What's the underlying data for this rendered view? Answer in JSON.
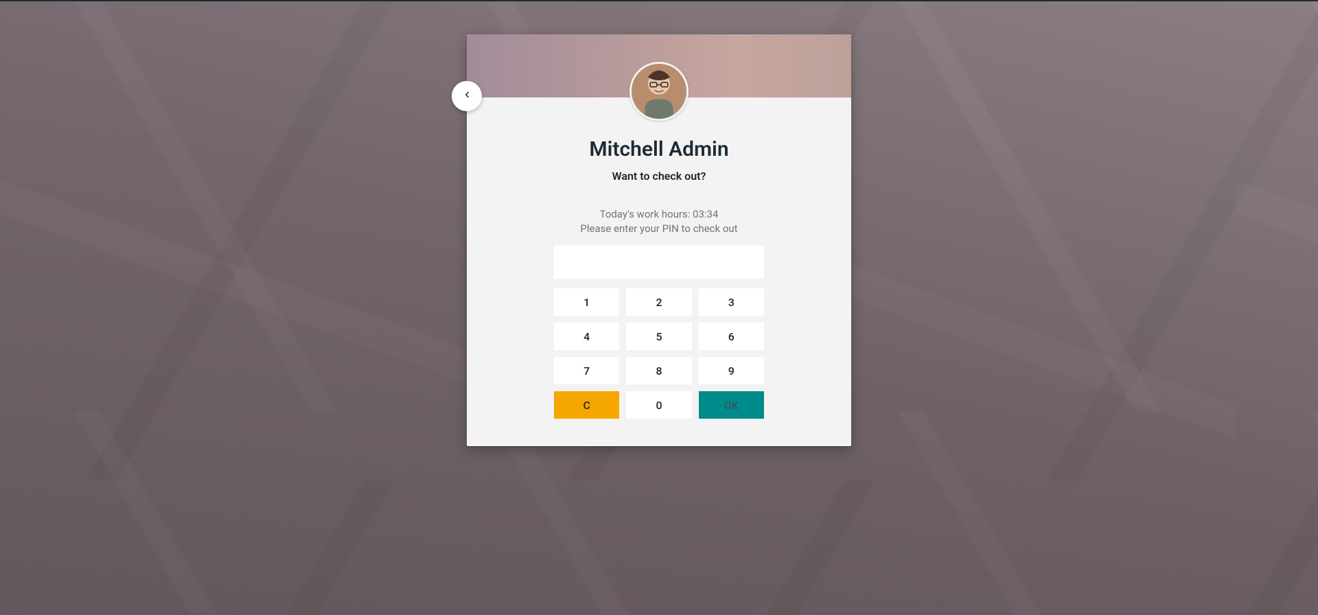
{
  "user": {
    "name": "Mitchell Admin"
  },
  "prompt": {
    "subtitle": "Want to check out?",
    "work_hours_line": "Today's work hours: 03:34",
    "pin_line": "Please enter your PIN to check out"
  },
  "keypad": {
    "k1": "1",
    "k2": "2",
    "k3": "3",
    "k4": "4",
    "k5": "5",
    "k6": "6",
    "k7": "7",
    "k8": "8",
    "k9": "9",
    "clear": "C",
    "k0": "0",
    "ok": "OK"
  },
  "colors": {
    "accent_warn": "#f5a700",
    "accent_ok": "#008b8b"
  }
}
